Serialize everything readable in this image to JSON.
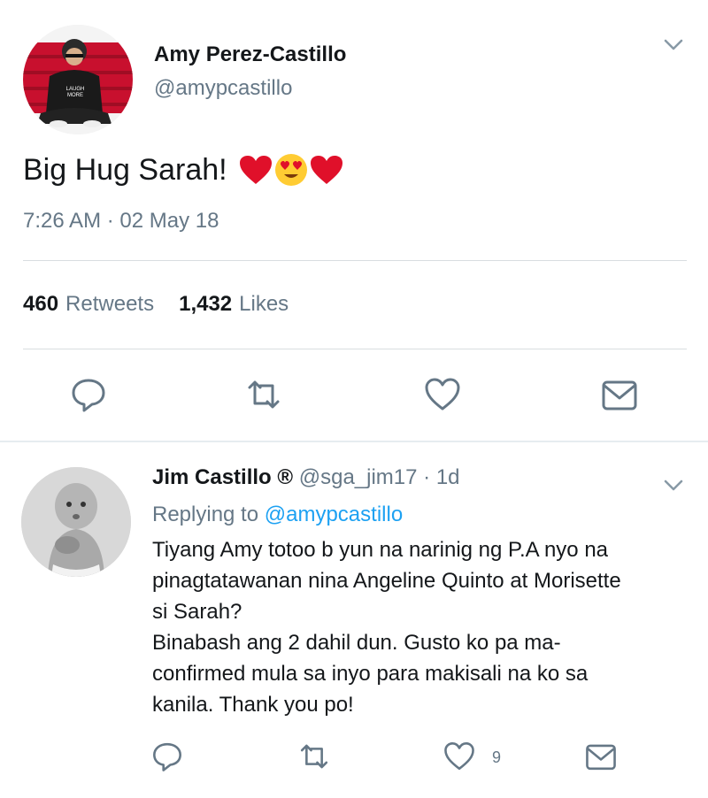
{
  "main_tweet": {
    "author_name": "Amy Perez-Castillo",
    "handle": "@amypcastillo",
    "avatar_shirt_text": "LAUGH MORE",
    "text": "Big Hug Sarah!",
    "emojis": [
      "red-heart-emoji",
      "heart-eyes-emoji",
      "red-heart-emoji"
    ],
    "timestamp": "7:26 AM · 02 May 18",
    "retweets_count": "460",
    "retweets_label": "Retweets",
    "likes_count": "1,432",
    "likes_label": "Likes",
    "actions": [
      "reply-icon",
      "retweet-icon",
      "like-icon",
      "share-icon"
    ]
  },
  "reply": {
    "author_name": "Jim Castillo ®",
    "handle_meta": "@sga_jim17 · 1d",
    "replying_to_prefix": "Replying to ",
    "replying_to_handle": "@amypcastillo",
    "lines": [
      "Tiyang Amy totoo b yun na narinig ng P.A nyo na",
      "pinagtatawanan nina Angeline Quinto at Morisette",
      "si Sarah?",
      "Binabash ang 2 dahil dun. Gusto ko pa ma-",
      "confirmed mula sa inyo para makisali na ko sa",
      "kanila. Thank you po!"
    ],
    "like_count": "9",
    "actions": [
      "reply-icon",
      "retweet-icon",
      "like-icon",
      "share-icon"
    ]
  },
  "colors": {
    "text_primary": "#14171a",
    "text_secondary": "#657786",
    "link": "#1da1f2",
    "divider": "#d9dde0",
    "heart_red": "#e0102a"
  }
}
